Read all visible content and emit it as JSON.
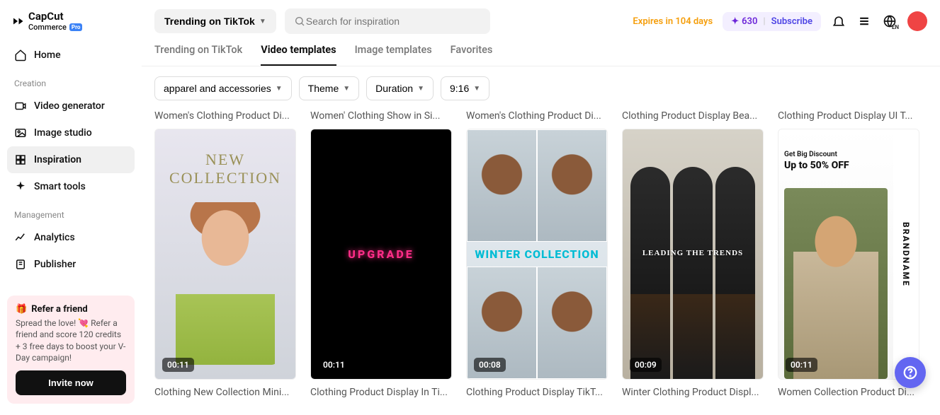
{
  "brand": {
    "name": "CapCut",
    "sub": "Commerce",
    "badge": "Pro"
  },
  "sidebar": {
    "home": "Home",
    "sections": {
      "creation": "Creation",
      "management": "Management"
    },
    "items": {
      "video_generator": "Video generator",
      "image_studio": "Image studio",
      "inspiration": "Inspiration",
      "smart_tools": "Smart tools",
      "analytics": "Analytics",
      "publisher": "Publisher"
    },
    "refer": {
      "title": "Refer a friend",
      "body": "Spread the love! 💘 Refer a friend and score 120 credits + 3 free days to boost your V-Day campaign!",
      "cta": "Invite now"
    }
  },
  "topbar": {
    "dropdown": "Trending on TikTok",
    "search_placeholder": "Search for inspiration",
    "expires": "Expires in 104 days",
    "credits": "630",
    "subscribe": "Subscribe",
    "lang": "EN"
  },
  "tabs": [
    "Trending on TikTok",
    "Video templates",
    "Image templates",
    "Favorites"
  ],
  "active_tab": 1,
  "filters": {
    "category": "apparel and accessories",
    "theme": "Theme",
    "duration": "Duration",
    "aspect": "9:16"
  },
  "cards": [
    {
      "title": "Women's Clothing Product Di...",
      "title2": "Clothing New Collection Mini...",
      "duration": "00:11",
      "art": {
        "line1": "NEW",
        "line2": "COLLECTION"
      }
    },
    {
      "title": "Women' Clothing Show in Si...",
      "title2": "Clothing Product Display In Ti...",
      "duration": "00:11",
      "art": {
        "text": "UPGRADE"
      }
    },
    {
      "title": "Women's Clothing Product Di...",
      "title2": "Clothing Product Display TikT...",
      "duration": "00:08",
      "art": {
        "text": "WINTER COLLECTION"
      }
    },
    {
      "title": "Clothing Product Display Bea...",
      "title2": "Winter Clothing Product Displ...",
      "duration": "00:09",
      "art": {
        "text": "LEADING THE TRENDS"
      }
    },
    {
      "title": "Clothing Product Display UI T...",
      "title2": "Women Collection Product Di...",
      "duration": "00:11",
      "art": {
        "line1": "Get Big Discount",
        "line2": "Up to 50% OFF",
        "brand": "BRANDNAME"
      }
    }
  ]
}
